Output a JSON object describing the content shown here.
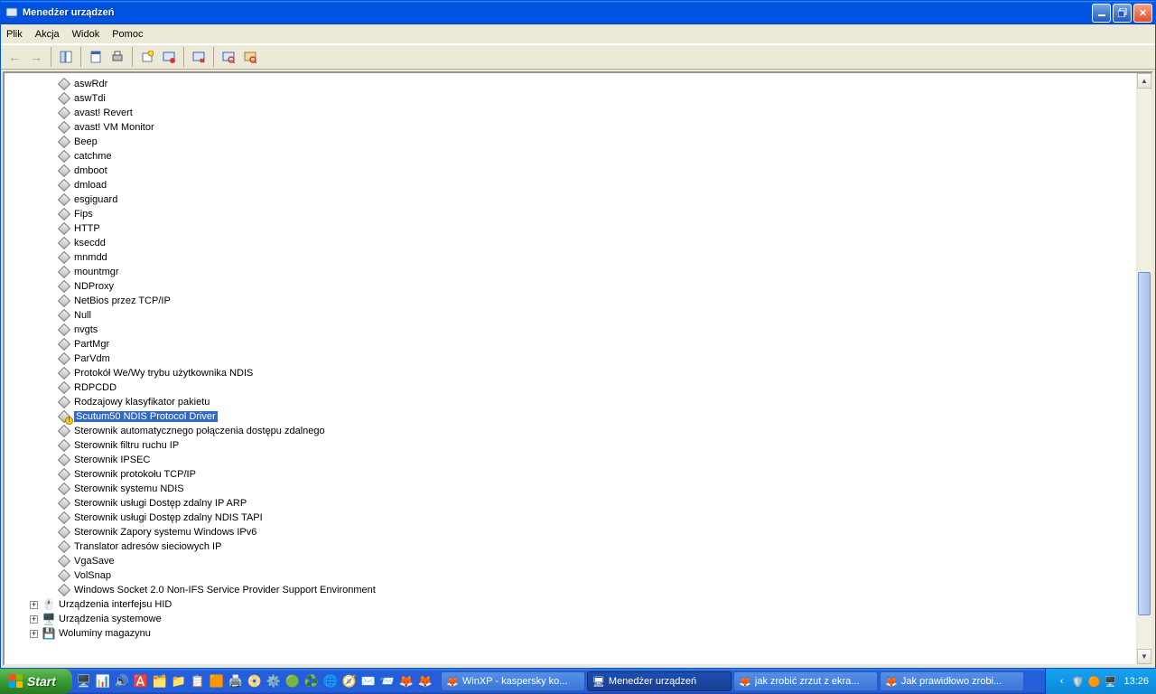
{
  "window": {
    "title": "Menedżer urządzeń"
  },
  "menu": {
    "plik": "Plik",
    "akcja": "Akcja",
    "widok": "Widok",
    "pomoc": "Pomoc"
  },
  "devices": [
    {
      "label": "aswRdr"
    },
    {
      "label": "aswTdi"
    },
    {
      "label": "avast! Revert"
    },
    {
      "label": "avast! VM Monitor"
    },
    {
      "label": "Beep"
    },
    {
      "label": "catchme"
    },
    {
      "label": "dmboot"
    },
    {
      "label": "dmload"
    },
    {
      "label": "esgiguard"
    },
    {
      "label": "Fips"
    },
    {
      "label": "HTTP"
    },
    {
      "label": "ksecdd"
    },
    {
      "label": "mnmdd"
    },
    {
      "label": "mountmgr"
    },
    {
      "label": "NDProxy"
    },
    {
      "label": "NetBios przez TCP/IP"
    },
    {
      "label": "Null"
    },
    {
      "label": "nvgts"
    },
    {
      "label": "PartMgr"
    },
    {
      "label": "ParVdm"
    },
    {
      "label": "Protokół We/Wy trybu użytkownika NDIS"
    },
    {
      "label": "RDPCDD"
    },
    {
      "label": "Rodzajowy klasyfikator pakietu"
    },
    {
      "label": "Scutum50 NDIS Protocol Driver",
      "selected": true,
      "warn": true
    },
    {
      "label": "Sterownik automatycznego połączenia dostępu zdalnego"
    },
    {
      "label": "Sterownik filtru ruchu IP"
    },
    {
      "label": "Sterownik IPSEC"
    },
    {
      "label": "Sterownik protokołu TCP/IP"
    },
    {
      "label": "Sterownik systemu NDIS"
    },
    {
      "label": "Sterownik usługi Dostęp zdalny IP ARP"
    },
    {
      "label": "Sterownik usługi Dostęp zdalny NDIS TAPI"
    },
    {
      "label": "Sterownik Zapory systemu Windows IPv6"
    },
    {
      "label": "Translator adresów sieciowych IP"
    },
    {
      "label": "VgaSave"
    },
    {
      "label": "VolSnap"
    },
    {
      "label": "Windows Socket 2.0 Non-IFS Service Provider Support Environment"
    }
  ],
  "categories": [
    {
      "label": "Urządzenia interfejsu HID",
      "glyph": "🖱️"
    },
    {
      "label": "Urządzenia systemowe",
      "glyph": "🖥️"
    },
    {
      "label": "Woluminy magazynu",
      "glyph": "💾"
    }
  ],
  "taskbar": {
    "start": "Start",
    "tasks": [
      {
        "label": "WinXP - kaspersky ko...",
        "icon": "🦊"
      },
      {
        "label": "Menedżer urządzeń",
        "icon": "🖥",
        "active": true
      },
      {
        "label": "jak zrobić zrzut z ekra...",
        "icon": "🦊"
      },
      {
        "label": "Jak prawidłowo zrobi...",
        "icon": "🦊"
      }
    ],
    "clock": "13:26"
  }
}
